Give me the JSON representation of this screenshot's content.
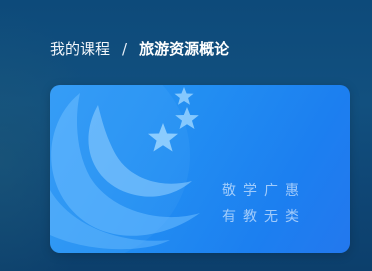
{
  "breadcrumb": {
    "parent_label": "我的课程",
    "separator": "/",
    "current_label": "旅游资源概论"
  },
  "course_card": {
    "motto_line_1": "敬学广惠",
    "motto_line_2": "有教无类",
    "colors": {
      "card_gradient_start": "#2f99f5",
      "card_gradient_end": "#2378ee",
      "emblem_fill": "#6bb8ff",
      "motto_text": "#d2e8ff"
    }
  },
  "page": {
    "background_color": "#12507f"
  }
}
